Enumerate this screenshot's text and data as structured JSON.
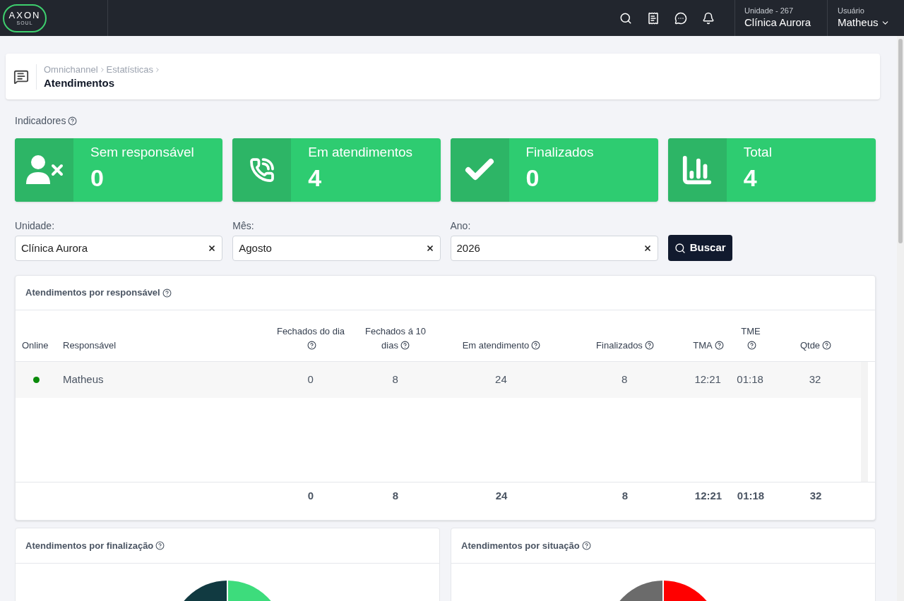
{
  "logo": {
    "text": "AXON",
    "sub": "SOUL"
  },
  "header": {
    "unit_label": "Unidade - 267",
    "unit_name": "Clínica Aurora",
    "user_label": "Usuário",
    "user_name": "Matheus"
  },
  "breadcrumb": {
    "path": [
      "Omnichannel",
      "Estatísticas"
    ],
    "title": "Atendimentos"
  },
  "indicators": {
    "title": "Indicadores",
    "cards": [
      {
        "kind": "unassigned",
        "label": "Sem responsável",
        "value": "0"
      },
      {
        "kind": "calls",
        "label": "Em atendimentos",
        "value": "4"
      },
      {
        "kind": "done",
        "label": "Finalizados",
        "value": "0"
      },
      {
        "kind": "total",
        "label": "Total",
        "value": "4"
      }
    ]
  },
  "filters": [
    {
      "label": "Unidade:",
      "value": "Clínica Aurora"
    },
    {
      "label": "Mês:",
      "value": "Agosto"
    },
    {
      "label": "Ano:",
      "value": "2026"
    }
  ],
  "search_button": "Buscar",
  "table": {
    "title": "Atendimentos por responsável",
    "columns": [
      {
        "label": "Online",
        "help": false
      },
      {
        "label": "Responsável",
        "help": false
      },
      {
        "label": "Fechados do dia",
        "help": true
      },
      {
        "label": "Fechados á 10 dias",
        "help": true
      },
      {
        "label": "Em atendimento",
        "help": true
      },
      {
        "label": "Finalizados",
        "help": true
      },
      {
        "label": "TMA",
        "help": true
      },
      {
        "label": "TME",
        "help": true
      },
      {
        "label": "Qtde",
        "help": true
      }
    ],
    "rows": [
      {
        "online": true,
        "name": "Matheus",
        "values": [
          "0",
          "8",
          "24",
          "8",
          "12:21",
          "01:18",
          "32"
        ]
      }
    ],
    "totals": [
      "0",
      "8",
      "24",
      "8",
      "12:21",
      "01:18",
      "32"
    ]
  },
  "charts": [
    {
      "title": "Atendimentos por finalização"
    },
    {
      "title": "Atendimentos por situação"
    }
  ]
}
